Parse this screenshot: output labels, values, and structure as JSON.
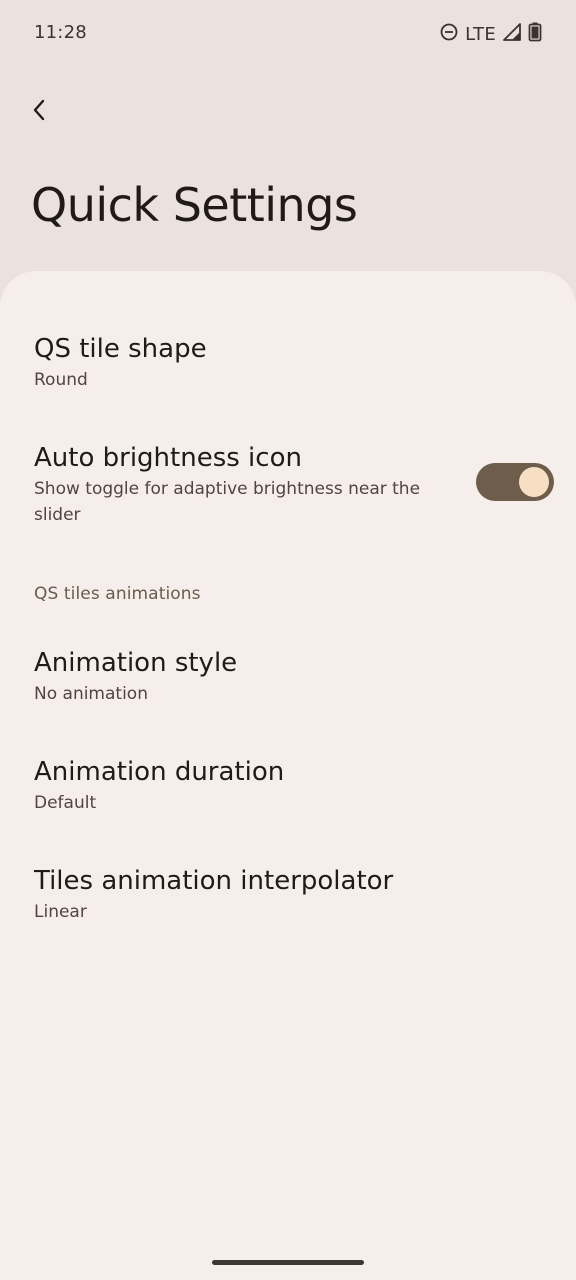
{
  "status_bar": {
    "time": "11:28",
    "network": "LTE"
  },
  "header": {
    "title": "Quick Settings"
  },
  "preferences": {
    "qs_tile_shape": {
      "title": "QS tile shape",
      "summary": "Round"
    },
    "auto_brightness_icon": {
      "title": "Auto brightness icon",
      "summary": "Show toggle for adaptive brightness near the slider",
      "enabled": true
    },
    "section_animations": {
      "label": "QS tiles animations"
    },
    "animation_style": {
      "title": "Animation style",
      "summary": "No animation"
    },
    "animation_duration": {
      "title": "Animation duration",
      "summary": "Default"
    },
    "interpolator": {
      "title": "Tiles animation interpolator",
      "summary": "Linear"
    }
  },
  "colors": {
    "header_bg": "#ebe2df",
    "card_bg": "#f6eeeb",
    "toggle_track": "#6d5d4a",
    "toggle_thumb": "#f7dfc4",
    "section_accent": "#6b5b4e"
  },
  "icons": {
    "dnd": "do-not-disturb-icon",
    "signal": "cell-signal-icon",
    "battery": "battery-icon",
    "back": "back-arrow-icon"
  }
}
